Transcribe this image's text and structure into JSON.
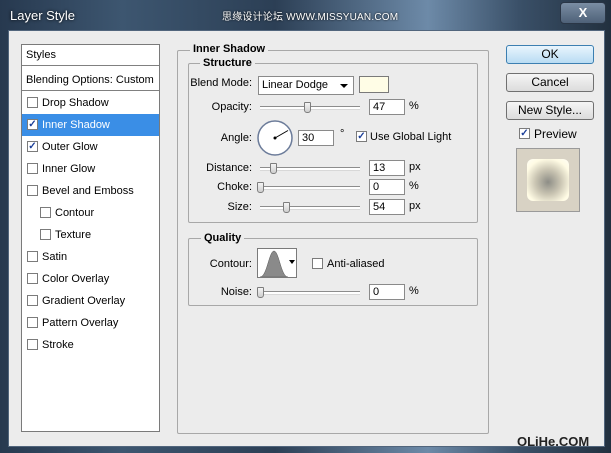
{
  "window": {
    "title": "Layer Style",
    "watermark": "思缘设计论坛 WWW.MISSYUAN.COM",
    "close_label": "X"
  },
  "styles_list": {
    "header": "Styles",
    "blending_options": "Blending Options: Custom",
    "items": [
      {
        "label": "Drop Shadow",
        "checked": false
      },
      {
        "label": "Inner Shadow",
        "checked": true,
        "selected": true
      },
      {
        "label": "Outer Glow",
        "checked": true
      },
      {
        "label": "Inner Glow",
        "checked": false
      },
      {
        "label": "Bevel and Emboss",
        "checked": false
      },
      {
        "label": "Contour",
        "checked": false,
        "indent": true
      },
      {
        "label": "Texture",
        "checked": false,
        "indent": true
      },
      {
        "label": "Satin",
        "checked": false
      },
      {
        "label": "Color Overlay",
        "checked": false
      },
      {
        "label": "Gradient Overlay",
        "checked": false
      },
      {
        "label": "Pattern Overlay",
        "checked": false
      },
      {
        "label": "Stroke",
        "checked": false
      }
    ]
  },
  "inner_shadow": {
    "title": "Inner Shadow",
    "structure_title": "Structure",
    "blend_mode_label": "Blend Mode:",
    "blend_mode_value": "Linear Dodge",
    "blend_color": "#fffde6",
    "opacity_label": "Opacity:",
    "opacity_value": "47",
    "opacity_fraction": 0.47,
    "percent": "%",
    "angle_label": "Angle:",
    "angle_value": "30",
    "degree": "°",
    "use_global_light_label": "Use Global Light",
    "use_global_light_checked": true,
    "distance_label": "Distance:",
    "distance_value": "13",
    "px": "px",
    "choke_label": "Choke:",
    "choke_value": "0",
    "size_label": "Size:",
    "size_value": "54"
  },
  "quality": {
    "title": "Quality",
    "contour_label": "Contour:",
    "anti_aliased_label": "Anti-aliased",
    "anti_aliased_checked": false,
    "noise_label": "Noise:",
    "noise_value": "0",
    "percent": "%"
  },
  "buttons": {
    "ok": "OK",
    "cancel": "Cancel",
    "new_style": "New Style...",
    "preview_label": "Preview",
    "preview_checked": true
  },
  "footer_watermark": "OLiHe.COM"
}
